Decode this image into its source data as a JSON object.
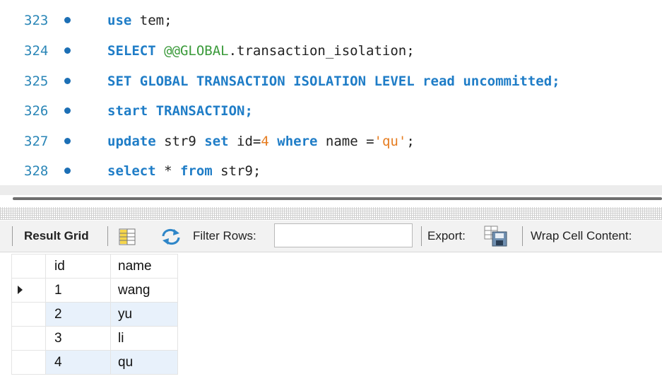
{
  "editor": {
    "lines": [
      {
        "num": "323",
        "tokens": [
          {
            "t": "use",
            "c": "kw"
          },
          {
            "t": " tem;",
            "c": "id"
          }
        ]
      },
      {
        "num": "324",
        "tokens": [
          {
            "t": "SELECT ",
            "c": "kw"
          },
          {
            "t": "@@GLOBAL",
            "c": "sysvar"
          },
          {
            "t": ".transaction_isolation;",
            "c": "id"
          }
        ]
      },
      {
        "num": "325",
        "tokens": [
          {
            "t": "SET GLOBAL TRANSACTION ISOLATION LEVEL read uncommitted;",
            "c": "kw"
          }
        ]
      },
      {
        "num": "326",
        "tokens": [
          {
            "t": "start TRANSACTION;",
            "c": "kw"
          }
        ]
      },
      {
        "num": "327",
        "tokens": [
          {
            "t": "update",
            "c": "kw"
          },
          {
            "t": " str9 ",
            "c": "id"
          },
          {
            "t": "set",
            "c": "kw"
          },
          {
            "t": " id=",
            "c": "id"
          },
          {
            "t": "4",
            "c": "num"
          },
          {
            "t": " where ",
            "c": "kw"
          },
          {
            "t": "name =",
            "c": "id"
          },
          {
            "t": "'qu'",
            "c": "str"
          },
          {
            "t": ";",
            "c": "id"
          }
        ]
      },
      {
        "num": "328",
        "tokens": [
          {
            "t": "select",
            "c": "kw"
          },
          {
            "t": " * ",
            "c": "id"
          },
          {
            "t": "from",
            "c": "kw"
          },
          {
            "t": " str9;",
            "c": "id"
          }
        ]
      }
    ]
  },
  "toolbar": {
    "result_grid_label": "Result Grid",
    "filter_label": "Filter Rows:",
    "filter_value": "",
    "export_label": "Export:",
    "wrap_label": "Wrap Cell Content:"
  },
  "grid": {
    "columns": [
      "id",
      "name"
    ],
    "rows": [
      {
        "id": "1",
        "name": "wang",
        "current": true
      },
      {
        "id": "2",
        "name": "yu",
        "current": false
      },
      {
        "id": "3",
        "name": "li",
        "current": false
      },
      {
        "id": "4",
        "name": "qu",
        "current": false
      }
    ]
  },
  "colors": {
    "keyword": "#1f7dc7",
    "line_number": "#2a86b7",
    "string_number": "#e67d21",
    "system_variable": "#3a9a3a",
    "alt_row": "#e8f1fb"
  },
  "icons": [
    "statement-dot-icon",
    "grid-view-icon",
    "refresh-arrows-icon",
    "export-icon",
    "row-pointer-icon"
  ]
}
